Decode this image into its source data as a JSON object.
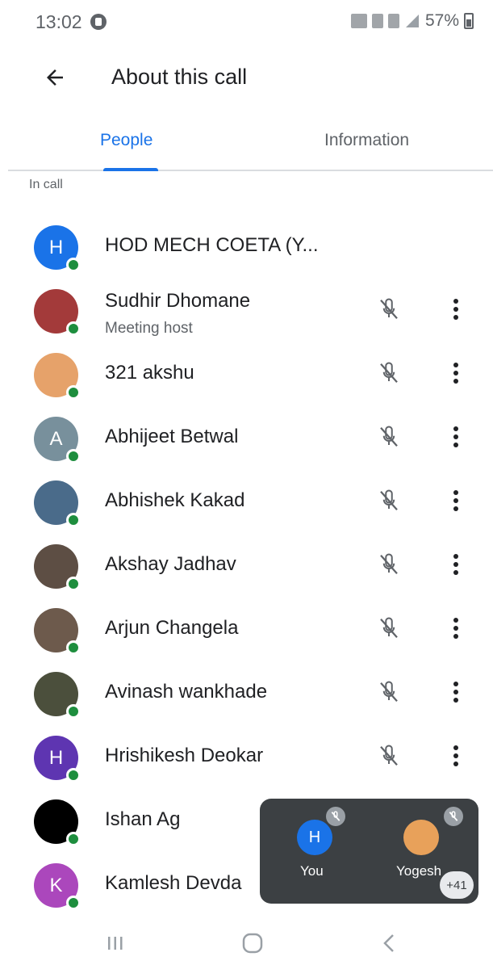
{
  "status_bar": {
    "time": "13:02",
    "battery": "57%"
  },
  "app_bar": {
    "title": "About this call"
  },
  "tabs": [
    {
      "label": "People",
      "selected": true
    },
    {
      "label": "Information",
      "selected": false
    }
  ],
  "section": {
    "label": "In call"
  },
  "participants": [
    {
      "name": "HOD MECH COETA (Y...",
      "subtitle": "",
      "avatar_letter": "H",
      "avatar_color": "#1a73e8",
      "mic_muted_icon": false
    },
    {
      "name": "Sudhir Dhomane",
      "subtitle": "Meeting host",
      "avatar_letter": "",
      "avatar_color": "#a33a3a",
      "mic_muted_icon": true
    },
    {
      "name": "321 akshu",
      "subtitle": "",
      "avatar_letter": "",
      "avatar_color": "#e6a26a",
      "mic_muted_icon": true
    },
    {
      "name": "Abhijeet Betwal",
      "subtitle": "",
      "avatar_letter": "A",
      "avatar_color": "#78909c",
      "mic_muted_icon": true
    },
    {
      "name": "Abhishek Kakad",
      "subtitle": "",
      "avatar_letter": "",
      "avatar_color": "#4a6b8a",
      "mic_muted_icon": true
    },
    {
      "name": "Akshay Jadhav",
      "subtitle": "",
      "avatar_letter": "",
      "avatar_color": "#5d4e44",
      "mic_muted_icon": true
    },
    {
      "name": "Arjun Changela",
      "subtitle": "",
      "avatar_letter": "",
      "avatar_color": "#6d5a4c",
      "mic_muted_icon": true
    },
    {
      "name": "Avinash wankhade",
      "subtitle": "",
      "avatar_letter": "",
      "avatar_color": "#4b4f3c",
      "mic_muted_icon": true
    },
    {
      "name": "Hrishikesh Deokar",
      "subtitle": "",
      "avatar_letter": "H",
      "avatar_color": "#5e35b1",
      "mic_muted_icon": true
    },
    {
      "name": "Ishan Ag",
      "subtitle": "",
      "avatar_letter": "",
      "avatar_color": "#000000",
      "mic_muted_icon": false
    },
    {
      "name": "Kamlesh Devda",
      "subtitle": "",
      "avatar_letter": "K",
      "avatar_color": "#ab47bc",
      "mic_muted_icon": false
    }
  ],
  "pip": {
    "tiles": [
      {
        "label": "You",
        "avatar_letter": "H",
        "avatar_color": "#1a73e8"
      },
      {
        "label": "Yogesh",
        "avatar_letter": "",
        "avatar_color": "#e8a15a"
      }
    ],
    "more_count": "+41"
  },
  "icons": {
    "back": "arrow-left-icon",
    "mic_off": "mic-off-icon",
    "more": "more-vert-icon",
    "online": "online-dot-icon",
    "nav_recents": "recents-icon",
    "nav_home": "home-icon",
    "nav_back": "nav-back-icon"
  },
  "colors": {
    "accent": "#1a73e8",
    "online": "#1e8e3e",
    "pip_bg": "#3c4043"
  }
}
